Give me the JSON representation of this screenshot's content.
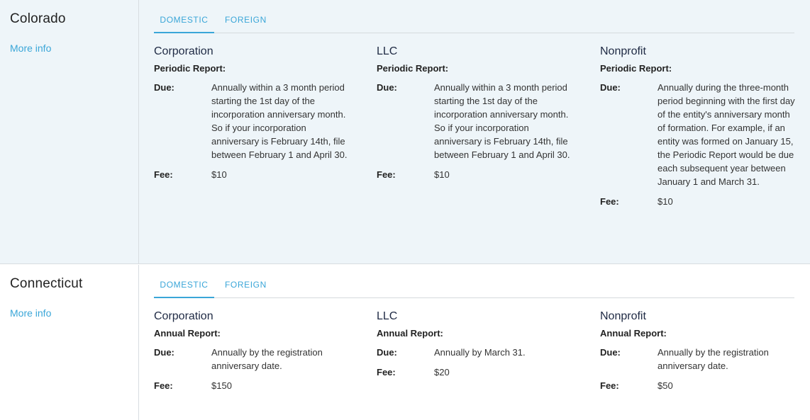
{
  "states": [
    {
      "name": "Colorado",
      "more_info": "More info",
      "tabs": {
        "domestic": "DOMESTIC",
        "foreign": "FOREIGN"
      },
      "entities": [
        {
          "title": "Corporation",
          "report": "Periodic Report:",
          "due_label": "Due:",
          "due": "Annually within a 3 month period starting the 1st day of the incorporation anniversary month. So if your incorporation anniversary is February 14th, file between February 1 and April 30.",
          "fee_label": "Fee:",
          "fee": "$10"
        },
        {
          "title": "LLC",
          "report": "Periodic Report:",
          "due_label": "Due:",
          "due": "Annually within a 3 month period starting the 1st day of the incorporation anniversary month. So if your incorporation anniversary is February 14th, file between February 1 and April 30.",
          "fee_label": "Fee:",
          "fee": "$10"
        },
        {
          "title": "Nonprofit",
          "report": "Periodic Report:",
          "due_label": "Due:",
          "due": "Annually during the three-month period beginning with the first day of the entity's anniversary month of formation. For example, if an entity was formed on January 15, the Periodic Report would be due each subsequent year between January 1 and March 31.",
          "fee_label": "Fee:",
          "fee": "$10"
        }
      ]
    },
    {
      "name": "Connecticut",
      "more_info": "More info",
      "tabs": {
        "domestic": "DOMESTIC",
        "foreign": "FOREIGN"
      },
      "entities": [
        {
          "title": "Corporation",
          "report": "Annual Report:",
          "due_label": "Due:",
          "due": "Annually by the registration anniversary date.",
          "fee_label": "Fee:",
          "fee": "$150"
        },
        {
          "title": "LLC",
          "report": "Annual Report:",
          "due_label": "Due:",
          "due": "Annually by March 31.",
          "fee_label": "Fee:",
          "fee": "$20"
        },
        {
          "title": "Nonprofit",
          "report": "Annual Report:",
          "due_label": "Due:",
          "due": "Annually by the registration anniversary date.",
          "fee_label": "Fee:",
          "fee": "$50"
        }
      ]
    }
  ]
}
